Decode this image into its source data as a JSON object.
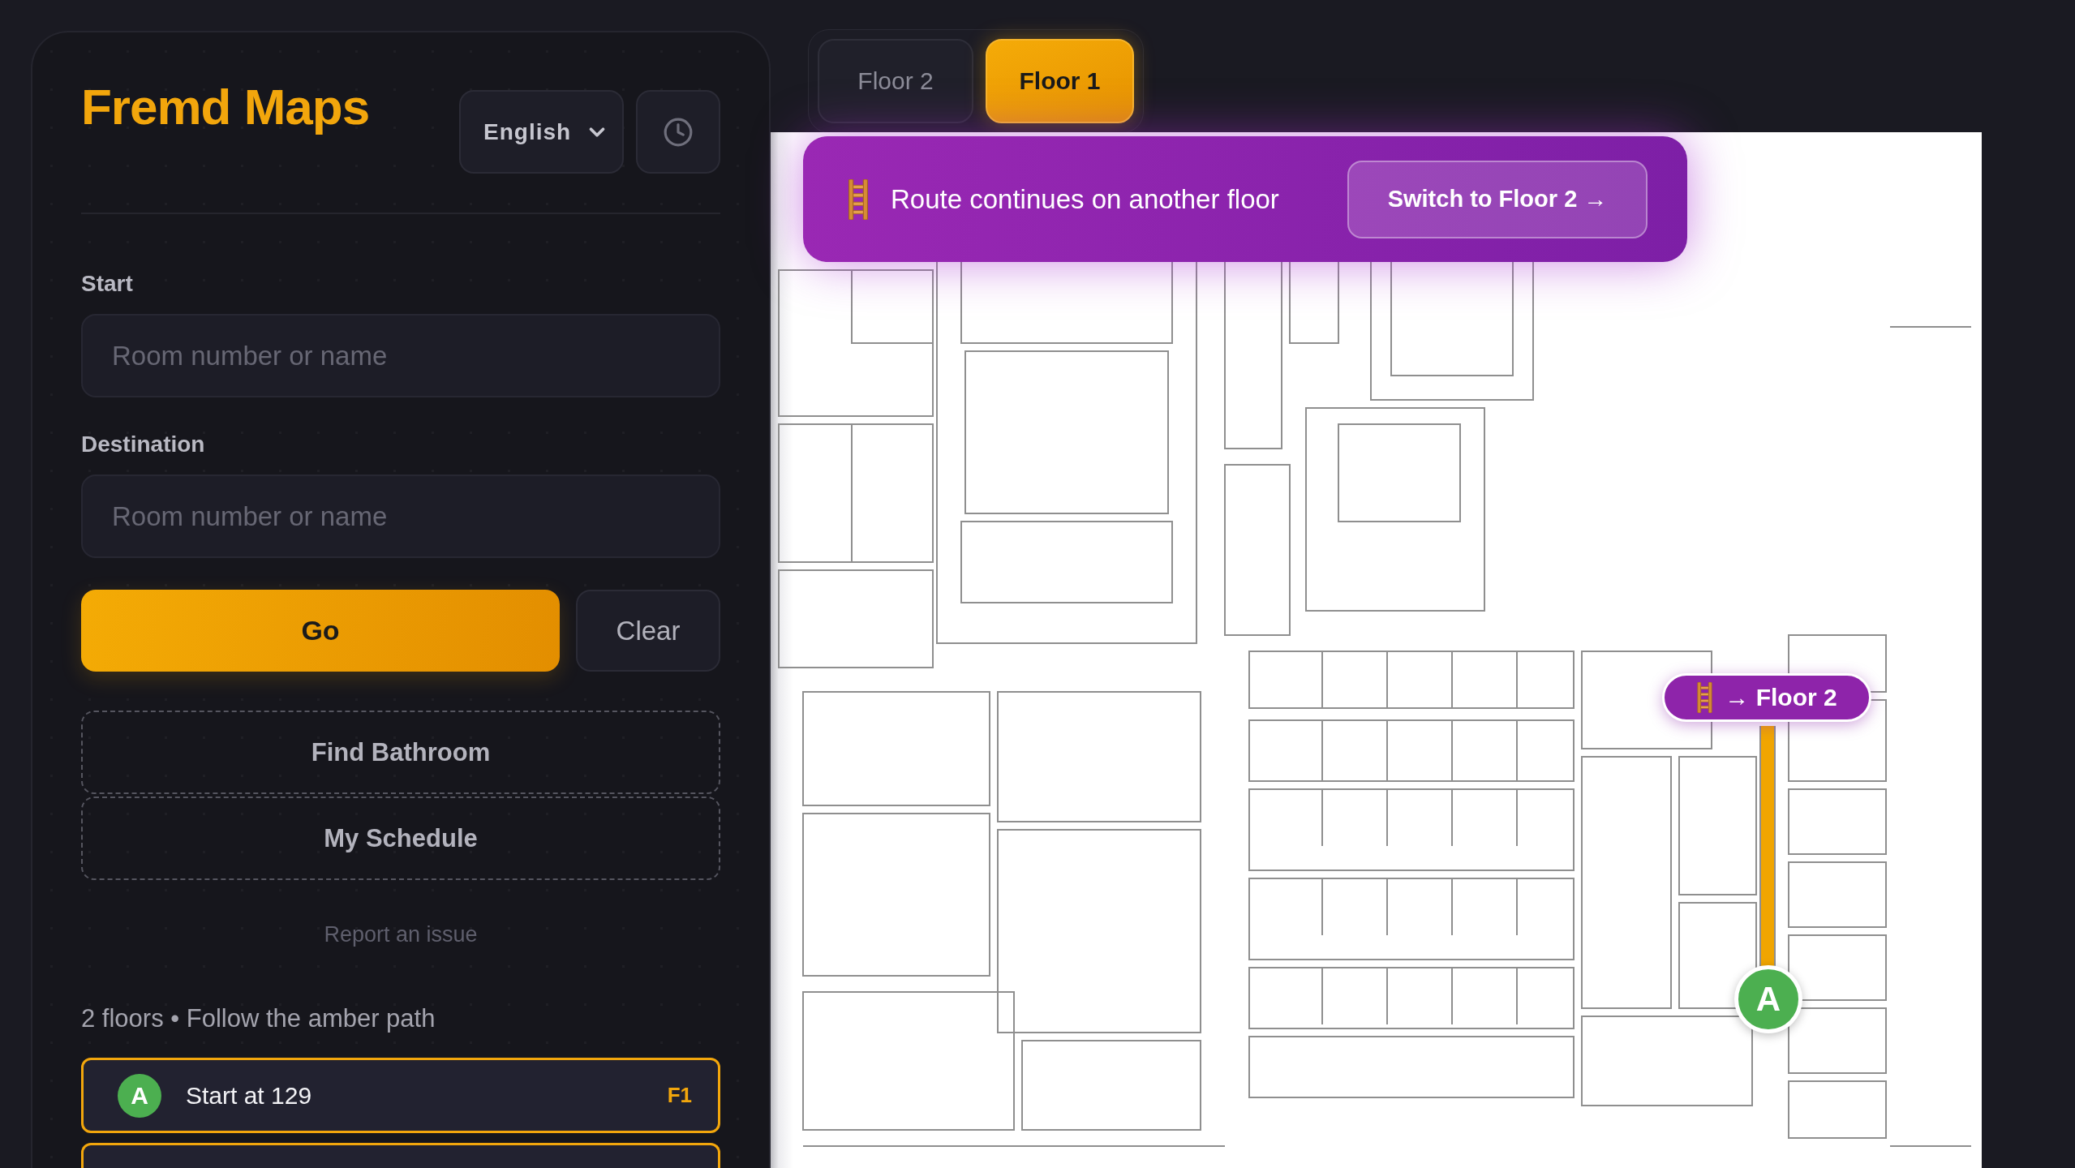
{
  "app": {
    "title": "Fremd Maps",
    "language": "English"
  },
  "form": {
    "fields": [
      {
        "label": "Start",
        "placeholder": "Room number or name"
      },
      {
        "label": "Destination",
        "placeholder": "Room number or name"
      }
    ],
    "primary_button": "Go",
    "secondary_button": "Clear",
    "quick_actions": [
      "Find Bathroom",
      "My Schedule"
    ],
    "report_link": "Report an issue"
  },
  "route": {
    "summary": "2 floors • Follow the amber path",
    "steps": [
      {
        "marker": "A",
        "label": "Start at 129",
        "floor": "F1",
        "highlighted": true
      },
      {
        "highlighted": true
      }
    ]
  },
  "floor_tabs": [
    {
      "label": "Floor 2",
      "selected": false
    },
    {
      "label": "Floor 1",
      "selected": true
    }
  ],
  "banner": {
    "message": "Route continues on another floor",
    "button": "Switch to Floor 2 →"
  },
  "map": {
    "transfer_badge": "→ Floor 2",
    "start_marker": "A"
  }
}
